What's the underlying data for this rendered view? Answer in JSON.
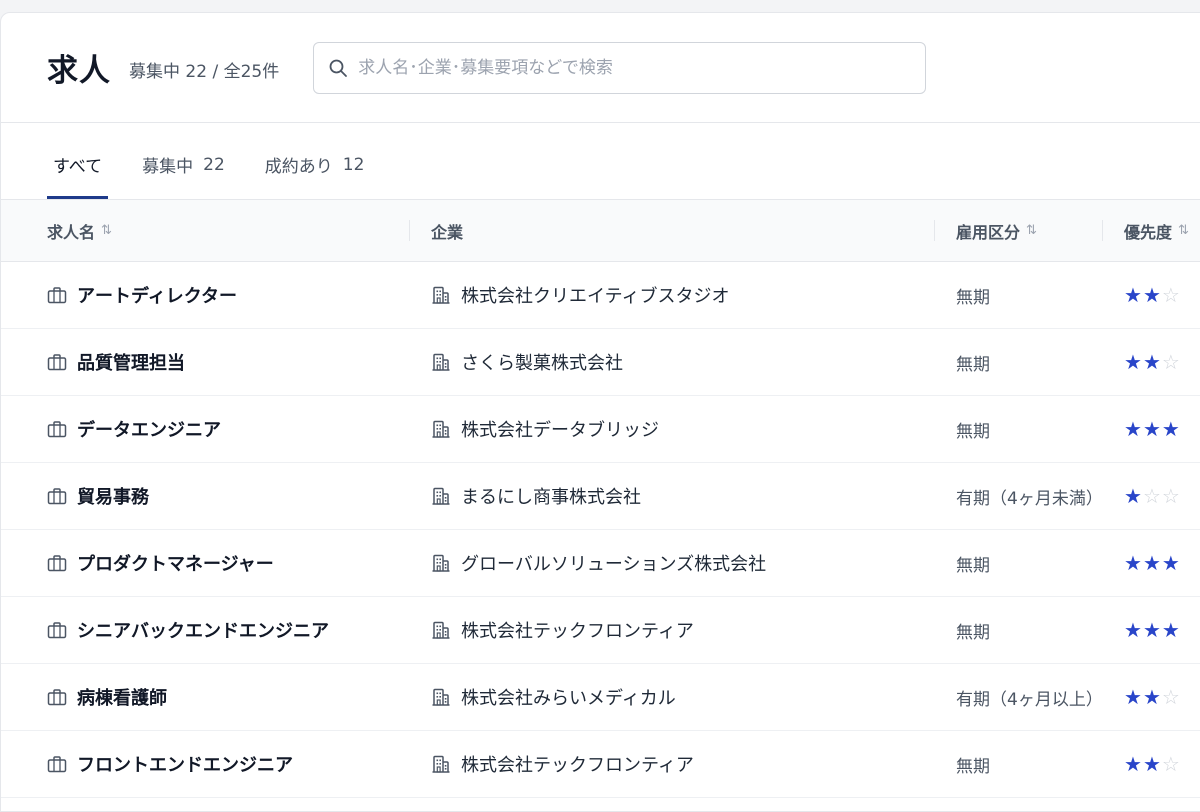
{
  "header": {
    "title": "求人",
    "count": "募集中 22 / 全25件",
    "search_placeholder": "求人名･企業･募集要項などで検索",
    "search_value": ""
  },
  "tabs": [
    {
      "label": "すべて",
      "count": "",
      "active": true
    },
    {
      "label": "募集中",
      "count": "22",
      "active": false
    },
    {
      "label": "成約あり",
      "count": "12",
      "active": false
    }
  ],
  "columns": {
    "job": "求人名",
    "company": "企業",
    "employment": "雇用区分",
    "priority": "優先度"
  },
  "sort_glyph": "⇅",
  "icons": {
    "job": "briefcase-icon",
    "company": "building-icon",
    "search": "search-icon"
  },
  "colors": {
    "accent": "#1e3a8a",
    "star_on": "#2945c9",
    "star_off": "#d1d5db"
  },
  "rows": [
    {
      "job": "アートディレクター",
      "company": "株式会社クリエイティブスタジオ",
      "employment": "無期",
      "priority": 2
    },
    {
      "job": "品質管理担当",
      "company": "さくら製菓株式会社",
      "employment": "無期",
      "priority": 2
    },
    {
      "job": "データエンジニア",
      "company": "株式会社データブリッジ",
      "employment": "無期",
      "priority": 3
    },
    {
      "job": "貿易事務",
      "company": "まるにし商事株式会社",
      "employment": "有期（4ヶ月未満）",
      "priority": 1
    },
    {
      "job": "プロダクトマネージャー",
      "company": "グローバルソリューションズ株式会社",
      "employment": "無期",
      "priority": 3
    },
    {
      "job": "シニアバックエンドエンジニア",
      "company": "株式会社テックフロンティア",
      "employment": "無期",
      "priority": 3
    },
    {
      "job": "病棟看護師",
      "company": "株式会社みらいメディカル",
      "employment": "有期（4ヶ月以上）",
      "priority": 2
    },
    {
      "job": "フロントエンドエンジニア",
      "company": "株式会社テックフロンティア",
      "employment": "無期",
      "priority": 2
    }
  ]
}
